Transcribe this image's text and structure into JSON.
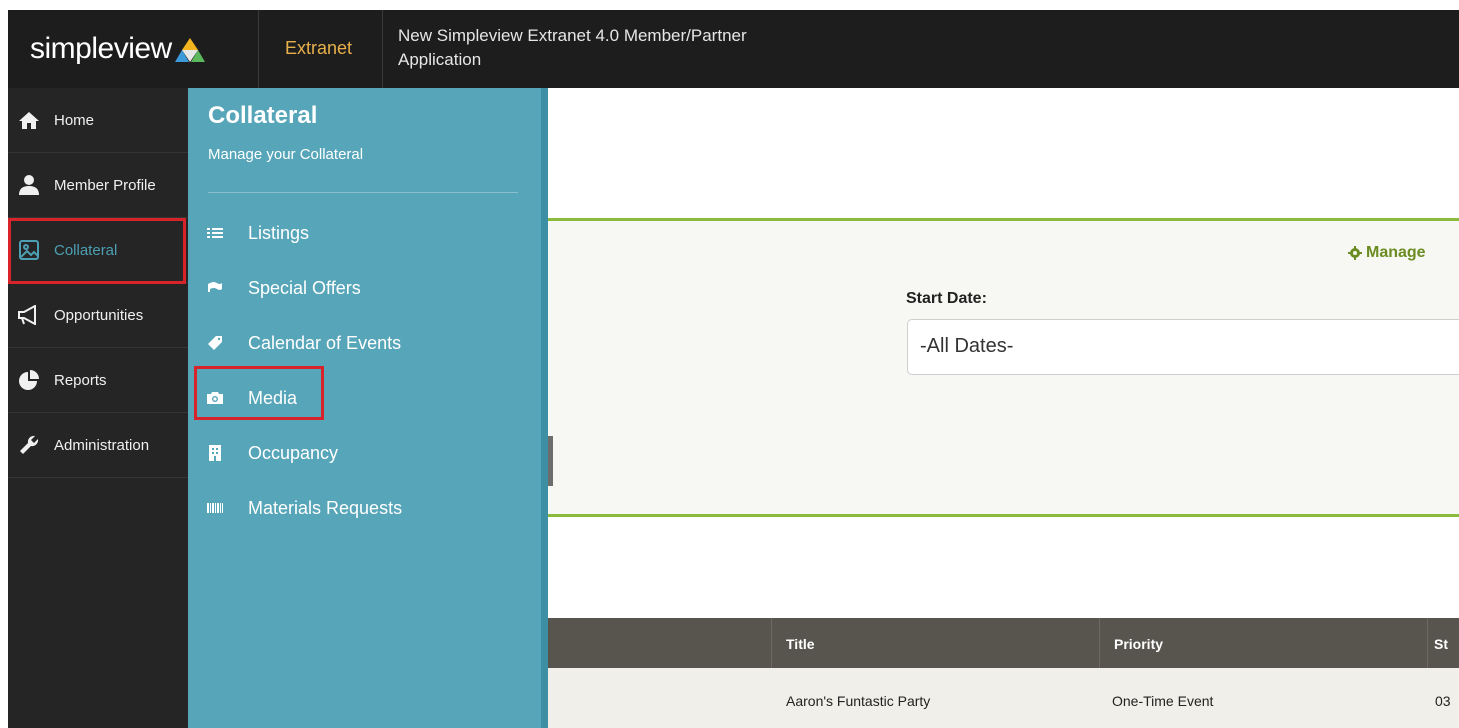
{
  "brand": {
    "logo_text": "simpleview",
    "section": "Extranet",
    "app_title": "New Simpleview Extranet 4.0 Member/Partner Application"
  },
  "colors": {
    "topbar": "#1d1d1d",
    "sidebar": "#252525",
    "flyout": "#57a5b8",
    "accent_green": "#8bbb3d",
    "highlight": "#d8232a",
    "extranet": "#e8b04b"
  },
  "sidebar": {
    "items": [
      {
        "label": "Home",
        "icon": "home-icon"
      },
      {
        "label": "Member Profile",
        "icon": "user-icon"
      },
      {
        "label": "Collateral",
        "icon": "image-icon",
        "active": true
      },
      {
        "label": "Opportunities",
        "icon": "megaphone-icon"
      },
      {
        "label": "Reports",
        "icon": "pie-chart-icon"
      },
      {
        "label": "Administration",
        "icon": "wrench-icon"
      }
    ]
  },
  "flyout": {
    "title": "Collateral",
    "subtitle": "Manage your Collateral",
    "items": [
      {
        "label": "Listings",
        "icon": "list-icon"
      },
      {
        "label": "Special Offers",
        "icon": "flag-icon"
      },
      {
        "label": "Calendar of Events",
        "icon": "tag-icon"
      },
      {
        "label": "Media",
        "icon": "camera-icon",
        "highlighted": true
      },
      {
        "label": "Occupancy",
        "icon": "building-icon"
      },
      {
        "label": "Materials Requests",
        "icon": "barcode-icon"
      }
    ]
  },
  "filters": {
    "manage_label": "Manage",
    "start_date_label": "Start Date:",
    "start_date_value": "-All Dates-"
  },
  "table": {
    "headers": [
      "Title",
      "Priority",
      "St"
    ],
    "rows": [
      {
        "title": "Aaron's Funtastic Party",
        "priority": "One-Time Event",
        "start": "03"
      }
    ]
  }
}
